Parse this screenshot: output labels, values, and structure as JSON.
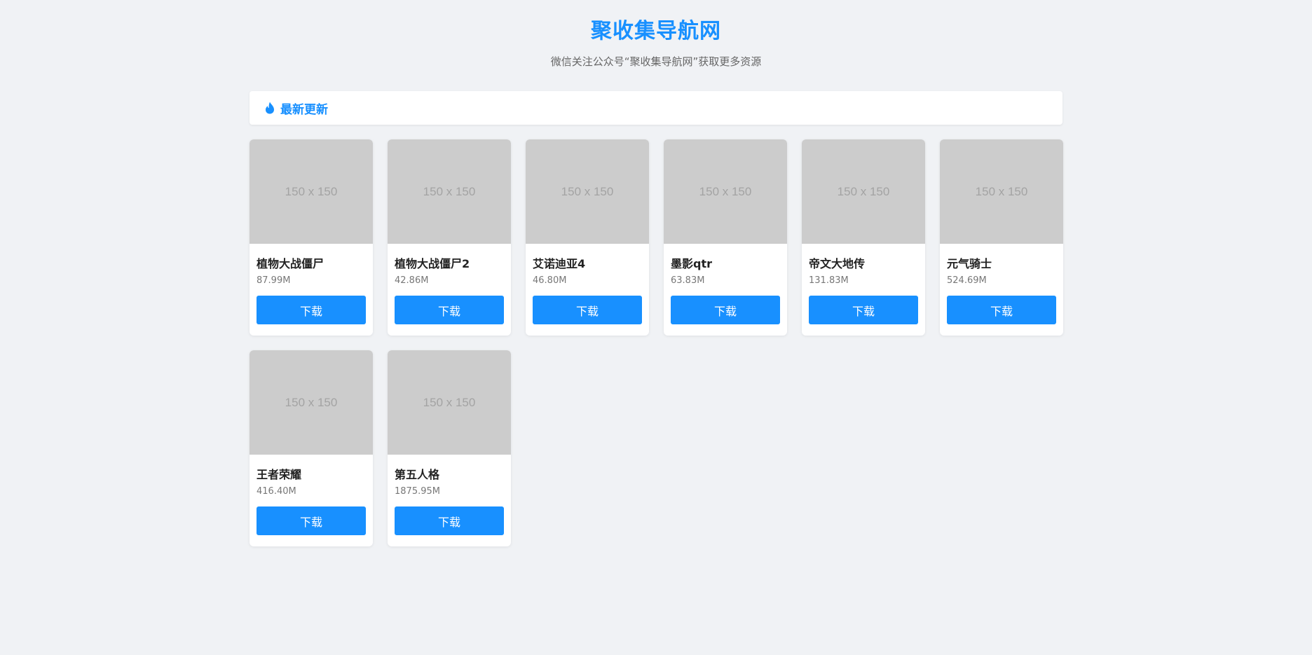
{
  "header": {
    "title": "聚收集导航网",
    "subtitle": "微信关注公众号“聚收集导航网”获取更多资源"
  },
  "section": {
    "title": "最新更新",
    "icon": "fire-icon"
  },
  "colors": {
    "accent": "#1890ff",
    "background": "#f0f2f5",
    "placeholder": "#cccccc"
  },
  "items": [
    {
      "thumb": "150 x 150",
      "name": "植物大战僵尸",
      "size": "87.99M",
      "button": "下载"
    },
    {
      "thumb": "150 x 150",
      "name": "植物大战僵尸2",
      "size": "42.86M",
      "button": "下载"
    },
    {
      "thumb": "150 x 150",
      "name": "艾诺迪亚4",
      "size": "46.80M",
      "button": "下载"
    },
    {
      "thumb": "150 x 150",
      "name": "墨影qtr",
      "size": "63.83M",
      "button": "下载"
    },
    {
      "thumb": "150 x 150",
      "name": "帝文大地传",
      "size": "131.83M",
      "button": "下载"
    },
    {
      "thumb": "150 x 150",
      "name": "元气骑士",
      "size": "524.69M",
      "button": "下载"
    },
    {
      "thumb": "150 x 150",
      "name": "王者荣耀",
      "size": "416.40M",
      "button": "下载"
    },
    {
      "thumb": "150 x 150",
      "name": "第五人格",
      "size": "1875.95M",
      "button": "下载"
    }
  ]
}
